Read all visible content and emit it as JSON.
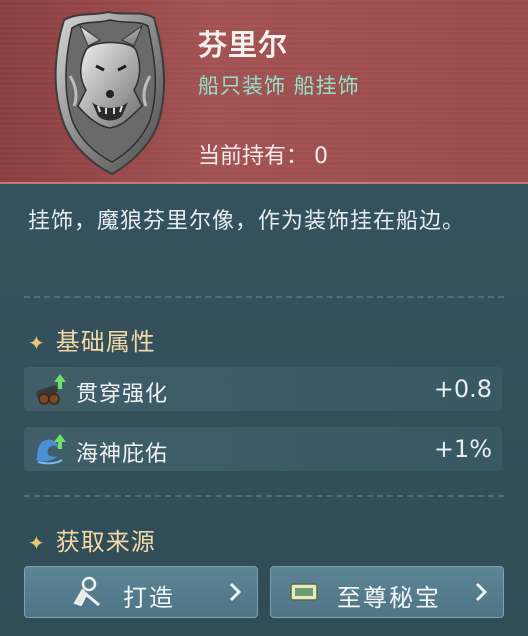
{
  "item": {
    "name": "芬里尔",
    "category": "船只装饰  船挂饰",
    "owned_label": "当前持有：",
    "owned_count": "0",
    "description": "挂饰，魔狼芬里尔像，作为装饰挂在船边。"
  },
  "attributes": {
    "title": "基础属性",
    "items": [
      {
        "icon": "cannon-upgrade-icon",
        "label": "贯穿强化",
        "value": "+0.8"
      },
      {
        "icon": "wave-upgrade-icon",
        "label": "海神庇佑",
        "value": "+1%"
      }
    ]
  },
  "sources": {
    "title": "获取来源",
    "buttons": [
      {
        "icon": "craft-icon",
        "label": "打造"
      },
      {
        "icon": "ticket-icon",
        "label": "至尊秘宝"
      }
    ]
  },
  "colors": {
    "header_red": "#9a4b4c",
    "subtitle_green": "#8fe3c9",
    "section_gold": "#f3d9a6",
    "panel_teal": "#33525e"
  }
}
